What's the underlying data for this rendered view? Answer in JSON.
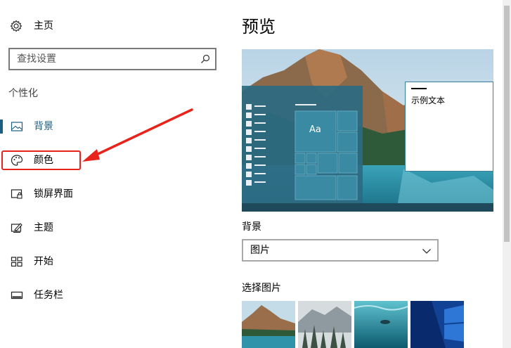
{
  "sidebar": {
    "home_label": "主页",
    "search": {
      "placeholder": "查找设置",
      "value": ""
    },
    "section_heading": "个性化",
    "items": [
      {
        "label": "背景",
        "icon": "picture-icon",
        "active": true
      },
      {
        "label": "颜色",
        "icon": "palette-icon",
        "active": false
      },
      {
        "label": "锁屏界面",
        "icon": "lock-screen-icon",
        "active": false
      },
      {
        "label": "主题",
        "icon": "theme-brush-icon",
        "active": false
      },
      {
        "label": "开始",
        "icon": "start-grid-icon",
        "active": false
      },
      {
        "label": "任务栏",
        "icon": "taskbar-icon",
        "active": false
      }
    ]
  },
  "annotation": {
    "highlight_color": "#e8231c",
    "target": "颜色"
  },
  "main": {
    "title": "预览",
    "preview": {
      "tile_label": "Aa",
      "sample_text": "示例文本"
    },
    "background_label": "背景",
    "background_select": {
      "value": "图片",
      "options": [
        "图片"
      ]
    },
    "choose_picture_label": "选择图片"
  },
  "colors": {
    "accent": "#1c5d82",
    "highlight": "#e8231c"
  }
}
